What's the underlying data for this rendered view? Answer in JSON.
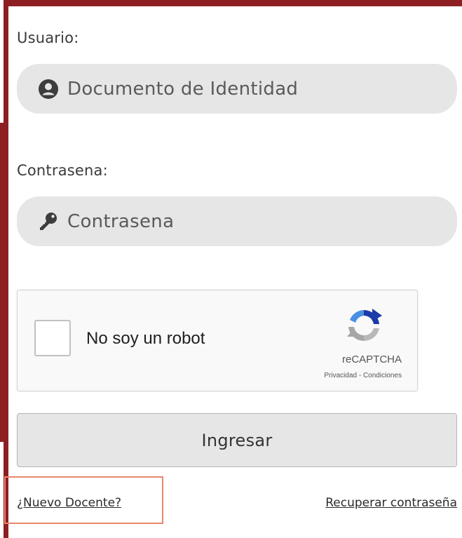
{
  "form": {
    "user_label": "Usuario:",
    "user_placeholder": "Documento de Identidad",
    "password_label": "Contrasena:",
    "password_placeholder": "Contrasena",
    "user_icon": "user-circle-icon",
    "password_icon": "key-icon"
  },
  "captcha": {
    "checkbox_label": "No soy un robot",
    "brand": "reCAPTCHA",
    "terms": "Privacidad - Condiciones",
    "logo_icon": "recaptcha-logo-icon"
  },
  "actions": {
    "submit_label": "Ingresar",
    "new_teacher_link": "¿Nuevo Docente?",
    "recover_password_link": "Recuperar contraseña"
  },
  "colors": {
    "frame": "#8d1f23",
    "field_bg": "#e6e6e6",
    "highlight": "#e8876b"
  }
}
